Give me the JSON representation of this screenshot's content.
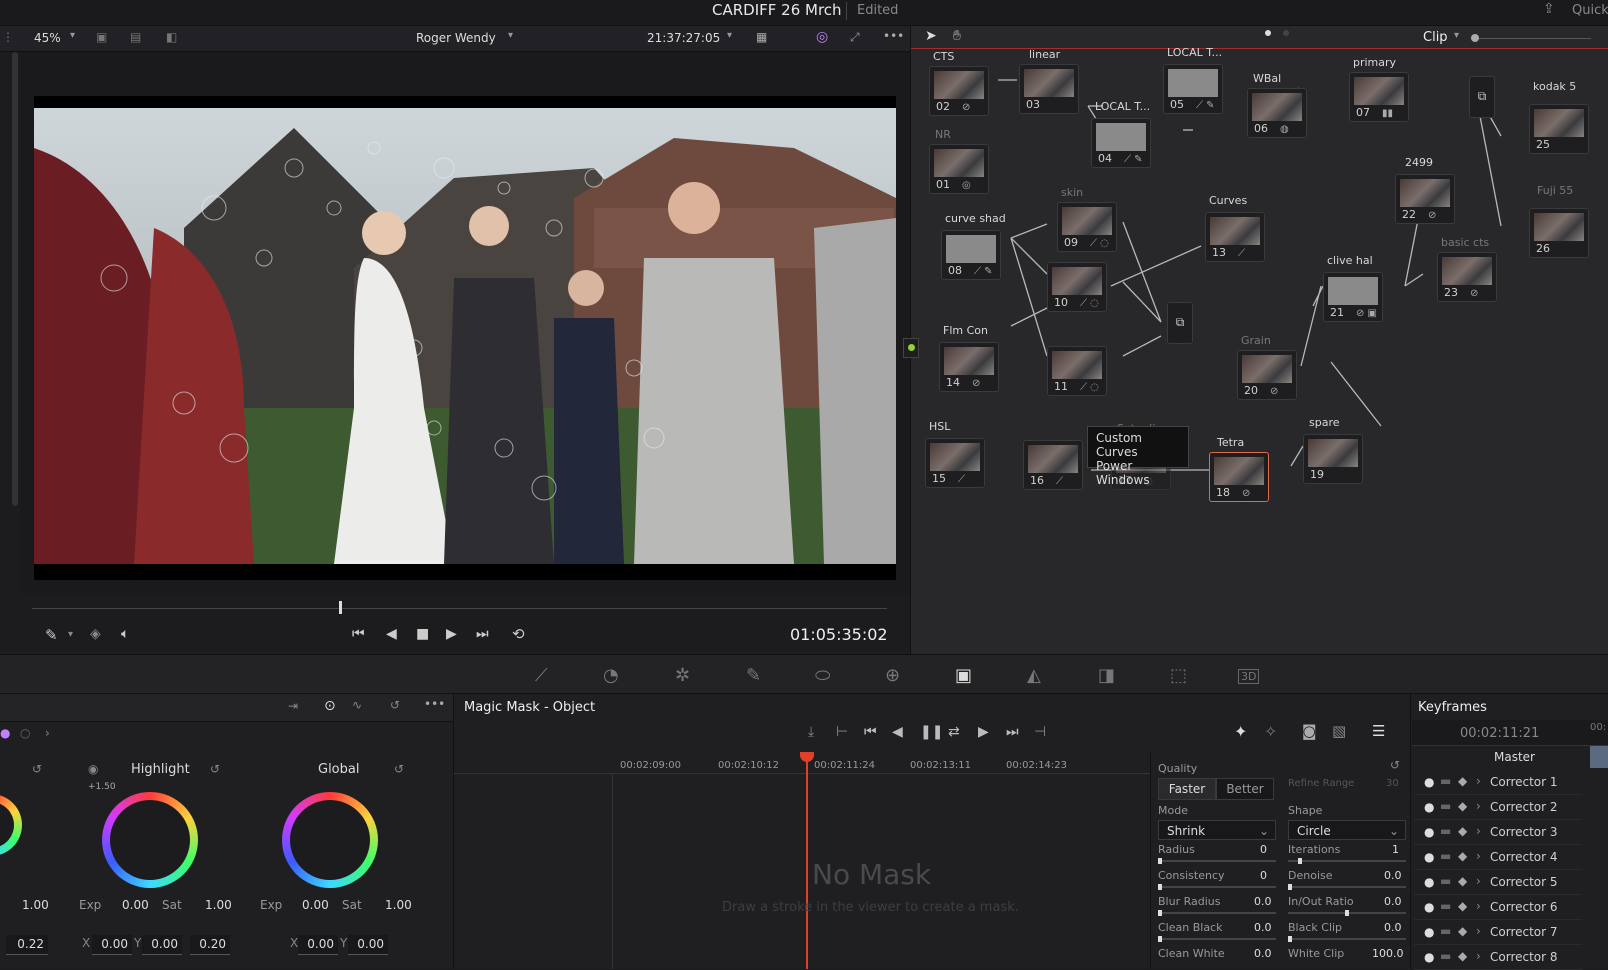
{
  "titlebar": {
    "project": "CARDIFF 26 Mrch",
    "status": "Edited",
    "quick": "Quick"
  },
  "viewer": {
    "zoom": "45%",
    "timeline_name": "Roger Wendy",
    "timecode_top": "21:37:27:05",
    "timecode": "01:05:35:02"
  },
  "node_editor": {
    "mode": "Clip",
    "nodes": [
      {
        "num": "02",
        "label": "CTS"
      },
      {
        "num": "03",
        "label": "linear"
      },
      {
        "num": "05",
        "label": "LOCAL T..."
      },
      {
        "num": "04",
        "label": "LOCAL T..."
      },
      {
        "num": "06",
        "label": "WBal"
      },
      {
        "num": "07",
        "label": "primary"
      },
      {
        "num": "01",
        "label": "NR"
      },
      {
        "num": "08",
        "label": "curve shad"
      },
      {
        "num": "09",
        "label": "skin"
      },
      {
        "num": "10",
        "label": ""
      },
      {
        "num": "13",
        "label": "Curves"
      },
      {
        "num": "14",
        "label": "Flm Con"
      },
      {
        "num": "11",
        "label": ""
      },
      {
        "num": "22",
        "label": "2499"
      },
      {
        "num": "21",
        "label": "clive hal"
      },
      {
        "num": "23",
        "label": "basic cts"
      },
      {
        "num": "20",
        "label": "Grain"
      },
      {
        "num": "15",
        "label": "HSL"
      },
      {
        "num": "16",
        "label": ""
      },
      {
        "num": "17",
        "label": "Sat adj"
      },
      {
        "num": "18",
        "label": "Tetra"
      },
      {
        "num": "19",
        "label": "spare"
      },
      {
        "num": "25",
        "label": "kodak 5"
      },
      {
        "num": "26",
        "label": "Fuji 55"
      }
    ],
    "tooltip": [
      "Custom Curves",
      "Power Windows"
    ]
  },
  "wheels": {
    "highlight": {
      "title": "Highlight",
      "badge": "+1.50",
      "exp_label": "Exp",
      "exp": "0.00",
      "sat_label": "Sat",
      "sat": "1.00",
      "x": "0.00",
      "y": "0.00",
      "z": "0.20"
    },
    "global": {
      "title": "Global",
      "exp_label": "Exp",
      "exp": "0.00",
      "sat_label": "Sat",
      "sat": "1.00",
      "x": "0.00",
      "y": "0.00"
    },
    "left": {
      "sat": "1.00",
      "z": "0.22"
    }
  },
  "magic_mask": {
    "title": "Magic Mask - Object",
    "ruler": [
      "00:02:09:00",
      "00:02:10:12",
      "00:02:11:24",
      "00:02:13:11",
      "00:02:14:23"
    ],
    "empty_title": "No Mask",
    "empty_hint": "Draw a stroke in the viewer to create a mask."
  },
  "quality": {
    "label": "Quality",
    "faster": "Faster",
    "better": "Better",
    "refine_label": "Refine Range",
    "refine_value": "30",
    "mode_label": "Mode",
    "mode_value": "Shrink",
    "shape_label": "Shape",
    "shape_value": "Circle",
    "params": [
      {
        "label": "Radius",
        "value": "0"
      },
      {
        "label": "Iterations",
        "value": "1"
      },
      {
        "label": "Consistency",
        "value": "0"
      },
      {
        "label": "Denoise",
        "value": "0.0"
      },
      {
        "label": "Blur Radius",
        "value": "0.0"
      },
      {
        "label": "In/Out Ratio",
        "value": "0.0"
      },
      {
        "label": "Clean Black",
        "value": "0.0"
      },
      {
        "label": "Black Clip",
        "value": "0.0"
      },
      {
        "label": "Clean White",
        "value": "0.0"
      },
      {
        "label": "White Clip",
        "value": "100.0"
      }
    ]
  },
  "keyframes": {
    "title": "Keyframes",
    "timecode": "00:02:11:21",
    "ruler": "00:",
    "master": "Master",
    "items": [
      "Corrector 1",
      "Corrector 2",
      "Corrector 3",
      "Corrector 4",
      "Corrector 5",
      "Corrector 6",
      "Corrector 7",
      "Corrector 8"
    ]
  }
}
